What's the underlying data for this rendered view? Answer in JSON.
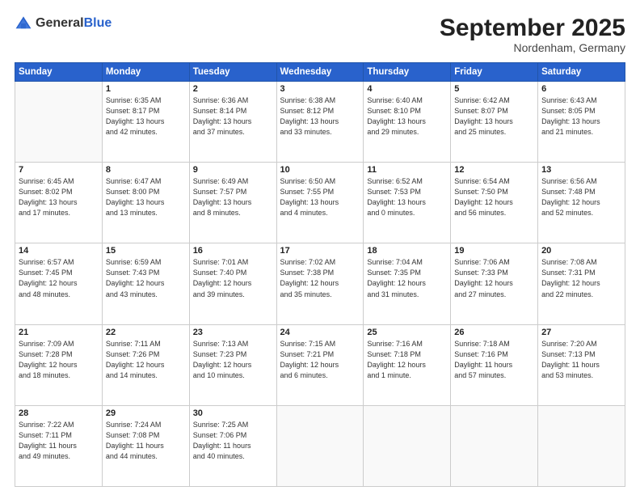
{
  "logo": {
    "general": "General",
    "blue": "Blue"
  },
  "header": {
    "month": "September 2025",
    "location": "Nordenham, Germany"
  },
  "weekdays": [
    "Sunday",
    "Monday",
    "Tuesday",
    "Wednesday",
    "Thursday",
    "Friday",
    "Saturday"
  ],
  "weeks": [
    [
      {
        "day": "",
        "info": ""
      },
      {
        "day": "1",
        "info": "Sunrise: 6:35 AM\nSunset: 8:17 PM\nDaylight: 13 hours\nand 42 minutes."
      },
      {
        "day": "2",
        "info": "Sunrise: 6:36 AM\nSunset: 8:14 PM\nDaylight: 13 hours\nand 37 minutes."
      },
      {
        "day": "3",
        "info": "Sunrise: 6:38 AM\nSunset: 8:12 PM\nDaylight: 13 hours\nand 33 minutes."
      },
      {
        "day": "4",
        "info": "Sunrise: 6:40 AM\nSunset: 8:10 PM\nDaylight: 13 hours\nand 29 minutes."
      },
      {
        "day": "5",
        "info": "Sunrise: 6:42 AM\nSunset: 8:07 PM\nDaylight: 13 hours\nand 25 minutes."
      },
      {
        "day": "6",
        "info": "Sunrise: 6:43 AM\nSunset: 8:05 PM\nDaylight: 13 hours\nand 21 minutes."
      }
    ],
    [
      {
        "day": "7",
        "info": "Sunrise: 6:45 AM\nSunset: 8:02 PM\nDaylight: 13 hours\nand 17 minutes."
      },
      {
        "day": "8",
        "info": "Sunrise: 6:47 AM\nSunset: 8:00 PM\nDaylight: 13 hours\nand 13 minutes."
      },
      {
        "day": "9",
        "info": "Sunrise: 6:49 AM\nSunset: 7:57 PM\nDaylight: 13 hours\nand 8 minutes."
      },
      {
        "day": "10",
        "info": "Sunrise: 6:50 AM\nSunset: 7:55 PM\nDaylight: 13 hours\nand 4 minutes."
      },
      {
        "day": "11",
        "info": "Sunrise: 6:52 AM\nSunset: 7:53 PM\nDaylight: 13 hours\nand 0 minutes."
      },
      {
        "day": "12",
        "info": "Sunrise: 6:54 AM\nSunset: 7:50 PM\nDaylight: 12 hours\nand 56 minutes."
      },
      {
        "day": "13",
        "info": "Sunrise: 6:56 AM\nSunset: 7:48 PM\nDaylight: 12 hours\nand 52 minutes."
      }
    ],
    [
      {
        "day": "14",
        "info": "Sunrise: 6:57 AM\nSunset: 7:45 PM\nDaylight: 12 hours\nand 48 minutes."
      },
      {
        "day": "15",
        "info": "Sunrise: 6:59 AM\nSunset: 7:43 PM\nDaylight: 12 hours\nand 43 minutes."
      },
      {
        "day": "16",
        "info": "Sunrise: 7:01 AM\nSunset: 7:40 PM\nDaylight: 12 hours\nand 39 minutes."
      },
      {
        "day": "17",
        "info": "Sunrise: 7:02 AM\nSunset: 7:38 PM\nDaylight: 12 hours\nand 35 minutes."
      },
      {
        "day": "18",
        "info": "Sunrise: 7:04 AM\nSunset: 7:35 PM\nDaylight: 12 hours\nand 31 minutes."
      },
      {
        "day": "19",
        "info": "Sunrise: 7:06 AM\nSunset: 7:33 PM\nDaylight: 12 hours\nand 27 minutes."
      },
      {
        "day": "20",
        "info": "Sunrise: 7:08 AM\nSunset: 7:31 PM\nDaylight: 12 hours\nand 22 minutes."
      }
    ],
    [
      {
        "day": "21",
        "info": "Sunrise: 7:09 AM\nSunset: 7:28 PM\nDaylight: 12 hours\nand 18 minutes."
      },
      {
        "day": "22",
        "info": "Sunrise: 7:11 AM\nSunset: 7:26 PM\nDaylight: 12 hours\nand 14 minutes."
      },
      {
        "day": "23",
        "info": "Sunrise: 7:13 AM\nSunset: 7:23 PM\nDaylight: 12 hours\nand 10 minutes."
      },
      {
        "day": "24",
        "info": "Sunrise: 7:15 AM\nSunset: 7:21 PM\nDaylight: 12 hours\nand 6 minutes."
      },
      {
        "day": "25",
        "info": "Sunrise: 7:16 AM\nSunset: 7:18 PM\nDaylight: 12 hours\nand 1 minute."
      },
      {
        "day": "26",
        "info": "Sunrise: 7:18 AM\nSunset: 7:16 PM\nDaylight: 11 hours\nand 57 minutes."
      },
      {
        "day": "27",
        "info": "Sunrise: 7:20 AM\nSunset: 7:13 PM\nDaylight: 11 hours\nand 53 minutes."
      }
    ],
    [
      {
        "day": "28",
        "info": "Sunrise: 7:22 AM\nSunset: 7:11 PM\nDaylight: 11 hours\nand 49 minutes."
      },
      {
        "day": "29",
        "info": "Sunrise: 7:24 AM\nSunset: 7:08 PM\nDaylight: 11 hours\nand 44 minutes."
      },
      {
        "day": "30",
        "info": "Sunrise: 7:25 AM\nSunset: 7:06 PM\nDaylight: 11 hours\nand 40 minutes."
      },
      {
        "day": "",
        "info": ""
      },
      {
        "day": "",
        "info": ""
      },
      {
        "day": "",
        "info": ""
      },
      {
        "day": "",
        "info": ""
      }
    ]
  ]
}
